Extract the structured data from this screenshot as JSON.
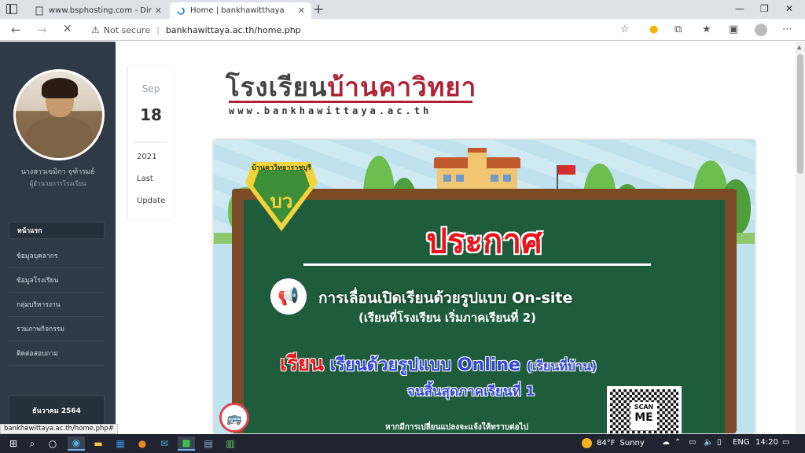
{
  "browser": {
    "tabs": [
      {
        "title": "www.bsphosting.com - DirectAd",
        "active": false
      },
      {
        "title": "Home | bankhawitthaya",
        "active": true
      }
    ],
    "address": {
      "security": "Not secure",
      "url": "bankhawittaya.ac.th/home.php"
    },
    "status_url": "bankhawittaya.ac.th/home.php#"
  },
  "sidebar": {
    "profile_name": "นางสาวเขมิกา จุฑ้ารมย์",
    "profile_role": "ผู้อำนวยการโรงเรียน",
    "nav": [
      {
        "label": "หน้าแรก",
        "active": true
      },
      {
        "label": "ข้อมูลบุคลากร",
        "active": false
      },
      {
        "label": "ข้อมูลโรงเรียน",
        "active": false
      },
      {
        "label": "กลุ่มบริหารงาน",
        "active": false
      },
      {
        "label": "รวมภาพกิจกรรม",
        "active": false
      },
      {
        "label": "ติดต่อสอบถาม",
        "active": false
      }
    ],
    "calendar_label": "ธันวาคม 2564"
  },
  "date_card": {
    "month": "Sep",
    "day": "18",
    "year": "2021",
    "label_1": "Last",
    "label_2": "Update"
  },
  "logo": {
    "part_1": "โรงเรียน",
    "part_2": "บ้านคาวิทยา",
    "url": "www.bankhawittaya.ac.th"
  },
  "banner": {
    "emblem_arc": "บ้านคาวิทยาราชบุรี",
    "emblem_letters": "บว",
    "headline": "ประกาศ",
    "line1": "การเลื่อนเปิดเรียนด้วยรูปแบบ On-site",
    "line2": "(เรียนที่โรงเรียน เริ่มภาคเรียนที่ 2)",
    "line3_red": "เรียน",
    "line3_blue": "เรียนด้วยรูปแบบ Online",
    "line3_small": "(เรียนที่บ้าน)",
    "line4": "จนสิ้นสุดภาคเรียนที่ 1",
    "line5": "หากมีการเปลี่ยนแปลงจะแจ้งให้ทราบต่อไป",
    "qr_scan": "SCAN",
    "qr_me": "ME"
  },
  "taskbar": {
    "weather_temp": "84°F",
    "weather_text": "Sunny",
    "language": "ENG",
    "time": "14:20"
  },
  "colors": {
    "sidebar_bg": "#2f3a46",
    "brand_red": "#b02134",
    "board_green": "#1f5c3c",
    "headline_red": "#e8131d",
    "text_blue": "#3348d6"
  }
}
